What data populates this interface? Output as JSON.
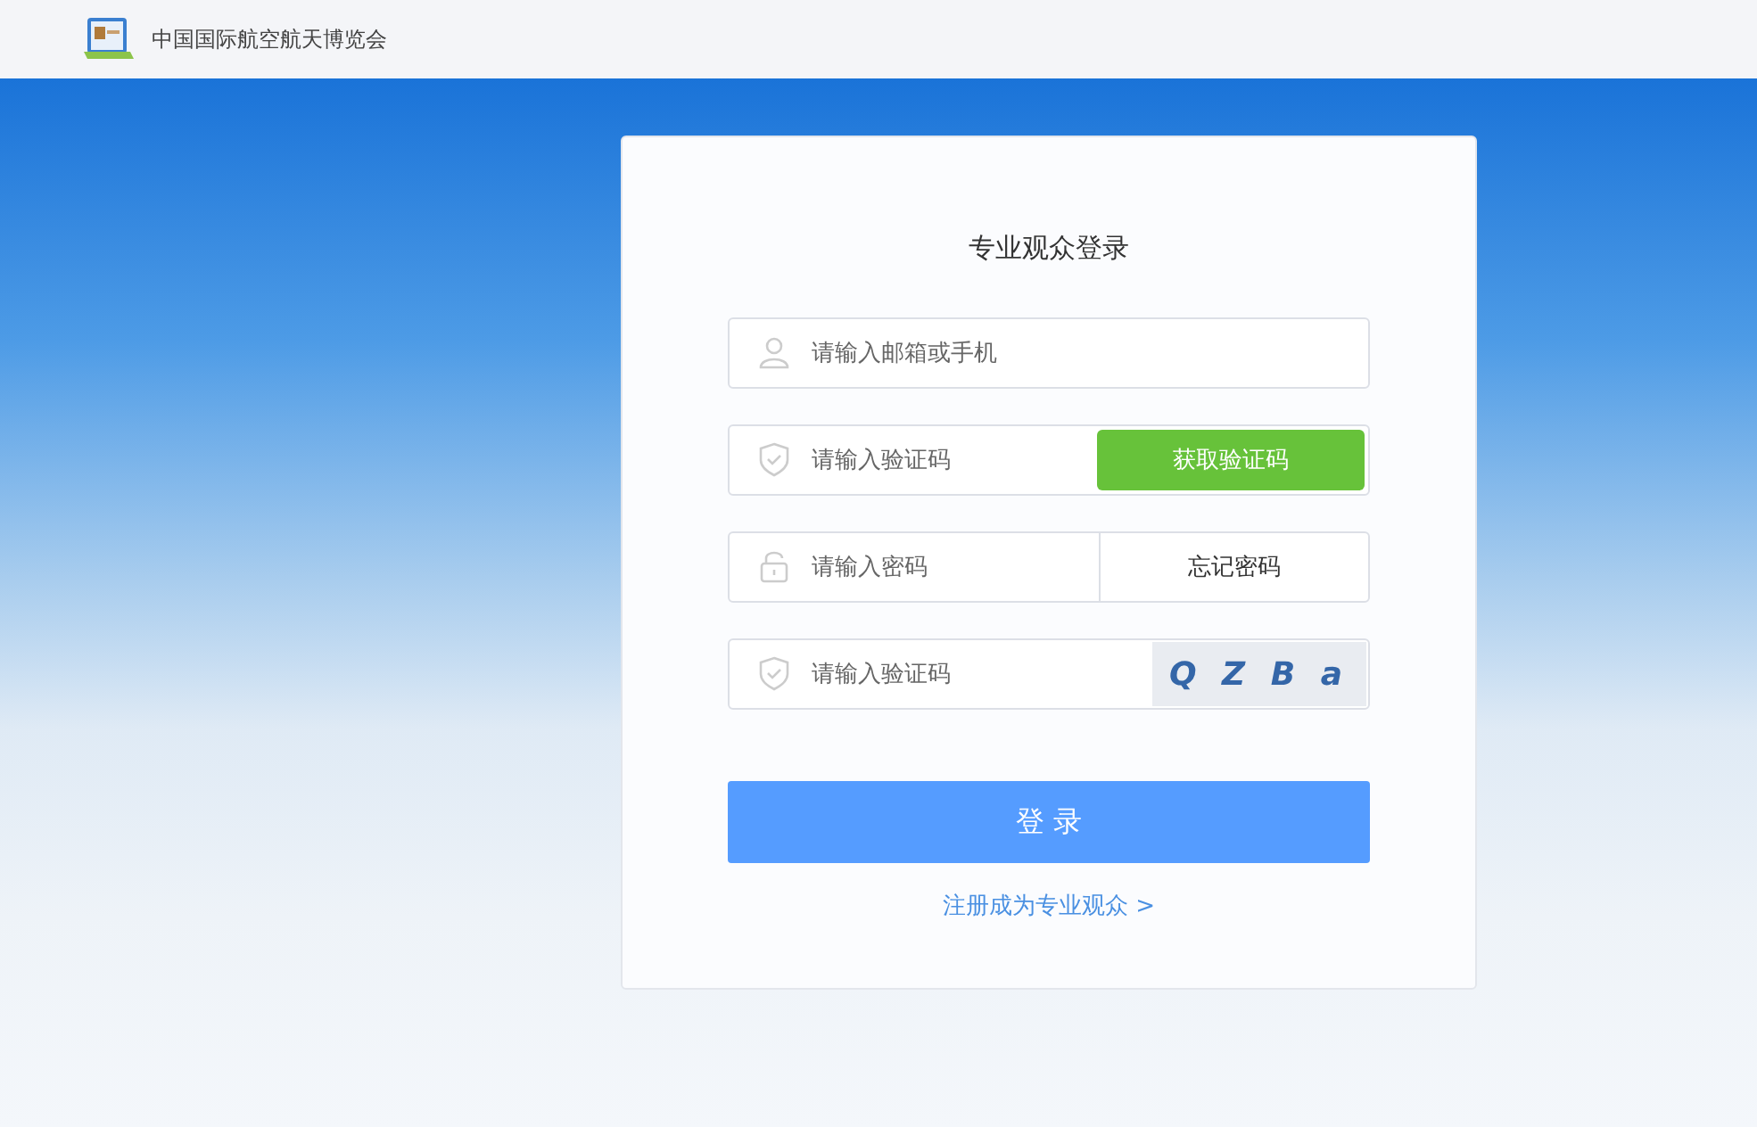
{
  "header": {
    "site_title": "中国国际航空航天博览会"
  },
  "login_card": {
    "title": "专业观众登录",
    "fields": [
      {
        "kind": "account",
        "placeholder": "请输入邮箱或手机"
      },
      {
        "kind": "sms",
        "placeholder": "请输入验证码",
        "action": "获取验证码"
      },
      {
        "kind": "password",
        "placeholder": "请输入密码",
        "action": "忘记密码"
      },
      {
        "kind": "captcha",
        "placeholder": "请输入验证码",
        "captcha_text": "Q Z B a"
      }
    ],
    "submit": "登 录",
    "register_link": "注册成为专业观众 >"
  }
}
